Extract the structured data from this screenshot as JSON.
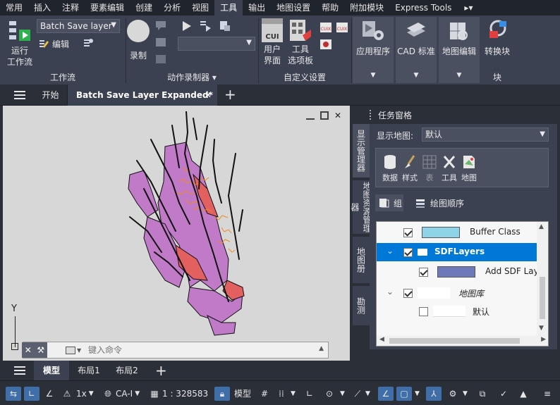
{
  "menubar": {
    "tabs": [
      "常用",
      "插入",
      "注释",
      "要素编辑",
      "创建",
      "分析",
      "视图",
      "工具",
      "输出",
      "地图设置",
      "帮助",
      "附加模块",
      "Express Tools"
    ],
    "active_tab": "工具",
    "more": "▸▾"
  },
  "ribbon": {
    "workflow": {
      "run_label": "运行\n工作流",
      "select_value": "Batch Save layer",
      "edit_label": "编辑",
      "panel_title": "工作流"
    },
    "action_recorder": {
      "record_label": "录制",
      "panel_title": "动作录制器"
    },
    "customize": {
      "ui_label": "用户\n界面",
      "tool_palette_label": "工具\n选项板",
      "cui_badge": "CUI",
      "panel_title": "自定义设置"
    },
    "groups": {
      "apps_label": "应用程序",
      "cad_label": "CAD 标准",
      "mapedit_label": "地图编辑",
      "convert_label": "转换块",
      "block_title": "块"
    }
  },
  "doctabs": {
    "start": "开始",
    "active": "Batch Save Layer Expanded*"
  },
  "drawing": {
    "ucs_y": "Y",
    "command_placeholder": "键入命令"
  },
  "taskpane": {
    "title": "任务窗格",
    "vtabs": [
      "显示管理器",
      "地图资源管理器",
      "地图册",
      "勘测"
    ],
    "show_map_label": "显示地图:",
    "show_map_value": "默认",
    "tools": [
      "数据",
      "样式",
      "表",
      "工具",
      "地图"
    ],
    "group_label": "组",
    "draw_order_label": "绘图顺序",
    "layers": [
      {
        "name": "Buffer Class",
        "checked": true,
        "swatch": "#8fd3e8"
      },
      {
        "name": "SDFLayers",
        "checked": true,
        "folder": true,
        "selected": true
      },
      {
        "name": "Add SDF Layer",
        "checked": true,
        "swatch": "#6d79b8"
      },
      {
        "name": "地图库",
        "checked": true,
        "italic": true
      },
      {
        "name": "默认",
        "checked": false
      }
    ]
  },
  "layouttabs": {
    "tabs": [
      "模型",
      "布局1",
      "布局2"
    ],
    "active": "模型"
  },
  "statusbar": {
    "scale_factor": "1x",
    "coord_system": "CA-I",
    "map_scale": "1 : 328583",
    "model_label": "模型"
  },
  "colors": {
    "accent": "#0078d7",
    "ribbon": "#3b4150",
    "map_fill": "#c07ac8",
    "map_river": "#111111",
    "map_orange": "#f08a1e",
    "map_red": "#e26060"
  }
}
